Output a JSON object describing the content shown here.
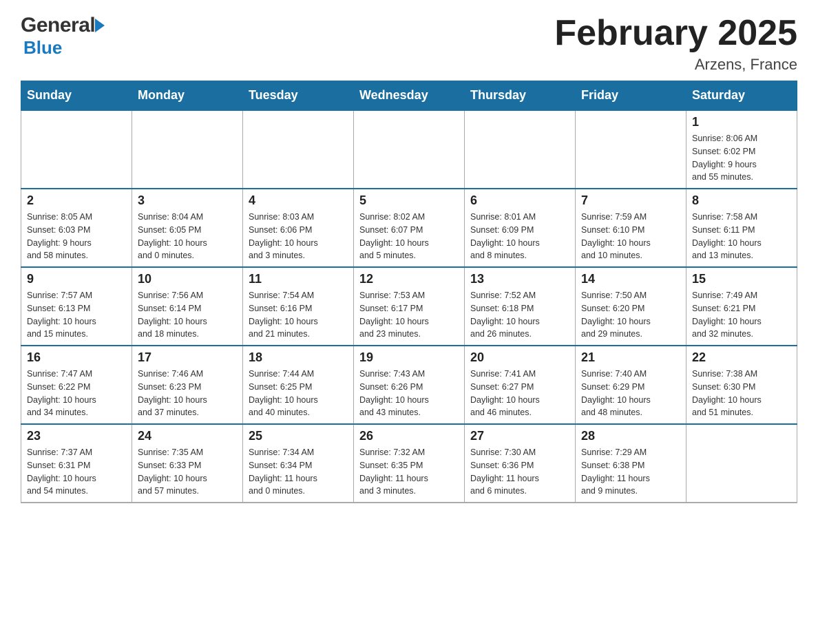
{
  "header": {
    "title": "February 2025",
    "location": "Arzens, France",
    "logo_general": "General",
    "logo_blue": "Blue"
  },
  "weekdays": [
    "Sunday",
    "Monday",
    "Tuesday",
    "Wednesday",
    "Thursday",
    "Friday",
    "Saturday"
  ],
  "weeks": [
    {
      "days": [
        {
          "number": "",
          "info": ""
        },
        {
          "number": "",
          "info": ""
        },
        {
          "number": "",
          "info": ""
        },
        {
          "number": "",
          "info": ""
        },
        {
          "number": "",
          "info": ""
        },
        {
          "number": "",
          "info": ""
        },
        {
          "number": "1",
          "info": "Sunrise: 8:06 AM\nSunset: 6:02 PM\nDaylight: 9 hours\nand 55 minutes."
        }
      ]
    },
    {
      "days": [
        {
          "number": "2",
          "info": "Sunrise: 8:05 AM\nSunset: 6:03 PM\nDaylight: 9 hours\nand 58 minutes."
        },
        {
          "number": "3",
          "info": "Sunrise: 8:04 AM\nSunset: 6:05 PM\nDaylight: 10 hours\nand 0 minutes."
        },
        {
          "number": "4",
          "info": "Sunrise: 8:03 AM\nSunset: 6:06 PM\nDaylight: 10 hours\nand 3 minutes."
        },
        {
          "number": "5",
          "info": "Sunrise: 8:02 AM\nSunset: 6:07 PM\nDaylight: 10 hours\nand 5 minutes."
        },
        {
          "number": "6",
          "info": "Sunrise: 8:01 AM\nSunset: 6:09 PM\nDaylight: 10 hours\nand 8 minutes."
        },
        {
          "number": "7",
          "info": "Sunrise: 7:59 AM\nSunset: 6:10 PM\nDaylight: 10 hours\nand 10 minutes."
        },
        {
          "number": "8",
          "info": "Sunrise: 7:58 AM\nSunset: 6:11 PM\nDaylight: 10 hours\nand 13 minutes."
        }
      ]
    },
    {
      "days": [
        {
          "number": "9",
          "info": "Sunrise: 7:57 AM\nSunset: 6:13 PM\nDaylight: 10 hours\nand 15 minutes."
        },
        {
          "number": "10",
          "info": "Sunrise: 7:56 AM\nSunset: 6:14 PM\nDaylight: 10 hours\nand 18 minutes."
        },
        {
          "number": "11",
          "info": "Sunrise: 7:54 AM\nSunset: 6:16 PM\nDaylight: 10 hours\nand 21 minutes."
        },
        {
          "number": "12",
          "info": "Sunrise: 7:53 AM\nSunset: 6:17 PM\nDaylight: 10 hours\nand 23 minutes."
        },
        {
          "number": "13",
          "info": "Sunrise: 7:52 AM\nSunset: 6:18 PM\nDaylight: 10 hours\nand 26 minutes."
        },
        {
          "number": "14",
          "info": "Sunrise: 7:50 AM\nSunset: 6:20 PM\nDaylight: 10 hours\nand 29 minutes."
        },
        {
          "number": "15",
          "info": "Sunrise: 7:49 AM\nSunset: 6:21 PM\nDaylight: 10 hours\nand 32 minutes."
        }
      ]
    },
    {
      "days": [
        {
          "number": "16",
          "info": "Sunrise: 7:47 AM\nSunset: 6:22 PM\nDaylight: 10 hours\nand 34 minutes."
        },
        {
          "number": "17",
          "info": "Sunrise: 7:46 AM\nSunset: 6:23 PM\nDaylight: 10 hours\nand 37 minutes."
        },
        {
          "number": "18",
          "info": "Sunrise: 7:44 AM\nSunset: 6:25 PM\nDaylight: 10 hours\nand 40 minutes."
        },
        {
          "number": "19",
          "info": "Sunrise: 7:43 AM\nSunset: 6:26 PM\nDaylight: 10 hours\nand 43 minutes."
        },
        {
          "number": "20",
          "info": "Sunrise: 7:41 AM\nSunset: 6:27 PM\nDaylight: 10 hours\nand 46 minutes."
        },
        {
          "number": "21",
          "info": "Sunrise: 7:40 AM\nSunset: 6:29 PM\nDaylight: 10 hours\nand 48 minutes."
        },
        {
          "number": "22",
          "info": "Sunrise: 7:38 AM\nSunset: 6:30 PM\nDaylight: 10 hours\nand 51 minutes."
        }
      ]
    },
    {
      "days": [
        {
          "number": "23",
          "info": "Sunrise: 7:37 AM\nSunset: 6:31 PM\nDaylight: 10 hours\nand 54 minutes."
        },
        {
          "number": "24",
          "info": "Sunrise: 7:35 AM\nSunset: 6:33 PM\nDaylight: 10 hours\nand 57 minutes."
        },
        {
          "number": "25",
          "info": "Sunrise: 7:34 AM\nSunset: 6:34 PM\nDaylight: 11 hours\nand 0 minutes."
        },
        {
          "number": "26",
          "info": "Sunrise: 7:32 AM\nSunset: 6:35 PM\nDaylight: 11 hours\nand 3 minutes."
        },
        {
          "number": "27",
          "info": "Sunrise: 7:30 AM\nSunset: 6:36 PM\nDaylight: 11 hours\nand 6 minutes."
        },
        {
          "number": "28",
          "info": "Sunrise: 7:29 AM\nSunset: 6:38 PM\nDaylight: 11 hours\nand 9 minutes."
        },
        {
          "number": "",
          "info": ""
        }
      ]
    }
  ]
}
